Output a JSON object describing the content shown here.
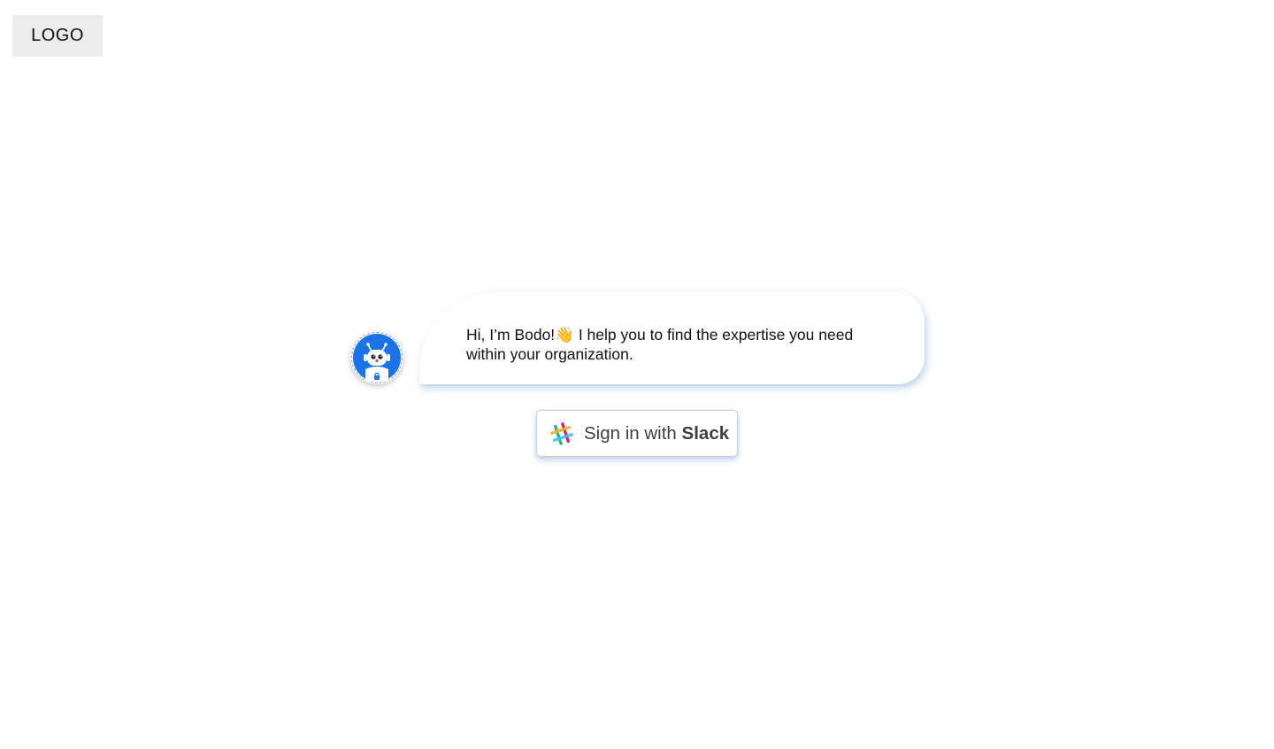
{
  "header": {
    "logo_text": "LOGO"
  },
  "chat": {
    "avatar_icon": "robot-bot-icon",
    "message": "Hi, I’m Bodo!👋 I help you to find the expertise you need within your organization."
  },
  "signin": {
    "icon": "slack-icon",
    "prefix": "Sign in with",
    "brand": "Slack"
  },
  "colors": {
    "avatar_blue": "#1a73e8",
    "bubble_shadow": "#6496c8",
    "slack_green": "#2eb67d",
    "slack_yellow": "#ecb22e",
    "slack_red": "#e01e5a",
    "slack_blue": "#36c5f0"
  }
}
